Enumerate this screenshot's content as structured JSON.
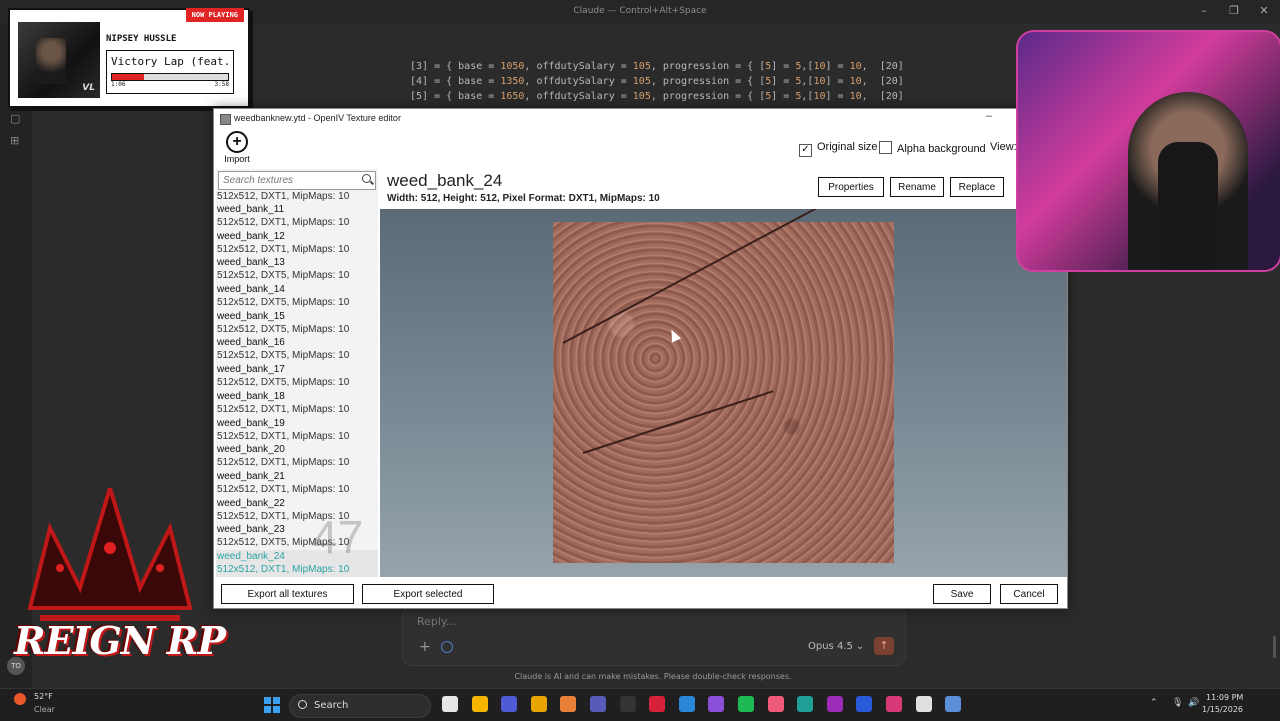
{
  "claude": {
    "title": "Claude — Control+Alt+Space",
    "code_lines": [
      {
        "idx": "[3]",
        "base": "1050",
        "salary": "105",
        "p5": "5",
        "p10": "10",
        "p20": "[20]"
      },
      {
        "idx": "[4]",
        "base": "1350",
        "salary": "105",
        "p5": "5",
        "p10": "10",
        "p20": "[20]"
      },
      {
        "idx": "[5]",
        "base": "1650",
        "salary": "105",
        "p5": "5",
        "p10": "10",
        "p20": "[20]"
      }
    ],
    "reply_placeholder": "Reply...",
    "model": "Opus 4.5",
    "disclaimer": "Claude is AI and can make mistakes. Please double-check responses."
  },
  "now_playing": {
    "badge": "NOW PLAYING",
    "artist": "NIPSEY HUSSLE",
    "title": "Victory Lap (feat...",
    "elapsed": "1:06",
    "duration": "3:58",
    "progress": 0.28,
    "cover_text": "VL"
  },
  "openiv": {
    "window_title": "weedbanknew.ytd - OpenIV Texture editor",
    "import_label": "Import",
    "original_size_label": "Original size",
    "original_size_checked": true,
    "alpha_background_label": "Alpha background",
    "alpha_background_checked": false,
    "view_label": "View:",
    "search_placeholder": "Search textures",
    "textures": [
      {
        "name": "",
        "format": "512x512, DXT1, MipMaps: 10"
      },
      {
        "name": "weed_bank_11",
        "format": "512x512, DXT1, MipMaps: 10"
      },
      {
        "name": "weed_bank_12",
        "format": "512x512, DXT1, MipMaps: 10"
      },
      {
        "name": "weed_bank_13",
        "format": "512x512, DXT5, MipMaps: 10"
      },
      {
        "name": "weed_bank_14",
        "format": "512x512, DXT5, MipMaps: 10"
      },
      {
        "name": "weed_bank_15",
        "format": "512x512, DXT5, MipMaps: 10"
      },
      {
        "name": "weed_bank_16",
        "format": "512x512, DXT5, MipMaps: 10"
      },
      {
        "name": "weed_bank_17",
        "format": "512x512, DXT5, MipMaps: 10"
      },
      {
        "name": "weed_bank_18",
        "format": "512x512, DXT1, MipMaps: 10"
      },
      {
        "name": "weed_bank_19",
        "format": "512x512, DXT1, MipMaps: 10"
      },
      {
        "name": "weed_bank_20",
        "format": "512x512, DXT1, MipMaps: 10"
      },
      {
        "name": "weed_bank_21",
        "format": "512x512, DXT1, MipMaps: 10"
      },
      {
        "name": "weed_bank_22",
        "format": "512x512, DXT1, MipMaps: 10"
      },
      {
        "name": "weed_bank_23",
        "format": "512x512, DXT5, MipMaps: 10"
      },
      {
        "name": "weed_bank_24",
        "format": "512x512, DXT1, MipMaps: 10",
        "selected": true
      }
    ],
    "texture_count": "47",
    "selected_name": "weed_bank_24",
    "selected_info": "Width: 512, Height: 512, Pixel Format: DXT1, MipMaps: 10",
    "buttons": {
      "properties": "Properties",
      "rename": "Rename",
      "replace": "Replace",
      "export_all": "Export all textures",
      "export_selected": "Export selected",
      "save": "Save",
      "cancel": "Cancel"
    }
  },
  "overlay": {
    "brand": "REIGN RP",
    "avatar": "TO"
  },
  "taskbar": {
    "temp": "52°F",
    "weather": "Clear",
    "search_label": "Search",
    "time": "11:09 PM",
    "date": "1/15/2026",
    "apps": [
      "file-explorer-icon",
      "chrome-icon",
      "discord-icon",
      "folder-icon",
      "affinity-icon",
      "unknown-app-icon",
      "terminal-icon",
      "acrobat-icon",
      "vscode-icon",
      "github-icon",
      "spotify-icon",
      "streaming-app-icon",
      "perplexity-icon",
      "hs-icon",
      "remote-icon",
      "maps-icon",
      "media-player-icon",
      "openiv-icon"
    ],
    "colors": {
      "accent": "#3aa0ef"
    }
  },
  "colors": {
    "selected_texture": "#2aa3a3",
    "now_playing_badge": "#e02424"
  }
}
